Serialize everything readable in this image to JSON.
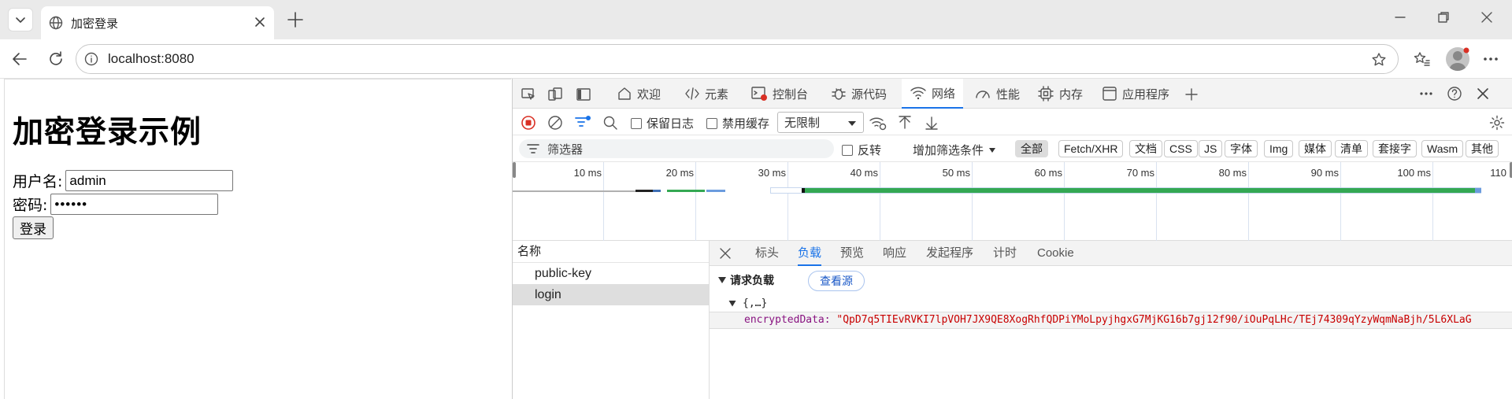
{
  "browser": {
    "tab_title": "加密登录",
    "url": "localhost:8080"
  },
  "page": {
    "heading": "加密登录示例",
    "username_label": "用户名:",
    "username_value": "admin",
    "password_label": "密码:",
    "password_value": "••••••",
    "login_button": "登录"
  },
  "devtools": {
    "tabs": [
      "欢迎",
      "元素",
      "控制台",
      "源代码",
      "网络",
      "性能",
      "内存",
      "应用程序"
    ],
    "active_tab": "网络",
    "toolbar": {
      "preserve_log": "保留日志",
      "disable_cache": "禁用缓存",
      "throttling": "无限制"
    },
    "filter": {
      "placeholder": "筛选器",
      "invert": "反转",
      "more_filters": "增加筛选条件",
      "types": [
        "全部",
        "Fetch/XHR",
        "文档",
        "CSS",
        "JS",
        "字体",
        "Img",
        "媒体",
        "清单",
        "套接字",
        "Wasm",
        "其他"
      ],
      "active_type": "全部"
    },
    "timeline": {
      "ticks": [
        "10 ms",
        "20 ms",
        "30 ms",
        "40 ms",
        "50 ms",
        "60 ms",
        "70 ms",
        "80 ms",
        "90 ms",
        "100 ms",
        "110"
      ]
    },
    "requests": {
      "header": "名称",
      "items": [
        "public-key",
        "login"
      ],
      "selected": "login"
    },
    "detail": {
      "tabs": [
        "标头",
        "负载",
        "预览",
        "响应",
        "发起程序",
        "计时",
        "Cookie"
      ],
      "active_tab": "负载",
      "section_title": "请求负载",
      "view_source": "查看源",
      "object_summary": "{,…}",
      "data_key": "encryptedData:",
      "data_value": "\"QpD7q5TIEvRVKI7lpVOH7JX9QE8XogRhfQDPiYMoLpyjhgxG7MjKG16b7gj12f90/iOuPqLHc/TEj74309qYzyWqmNaBjh/5L6XLaG"
    },
    "colors": {
      "accent": "#1a73e8",
      "record": "#d93025",
      "waterfall_green": "#34a853"
    }
  }
}
